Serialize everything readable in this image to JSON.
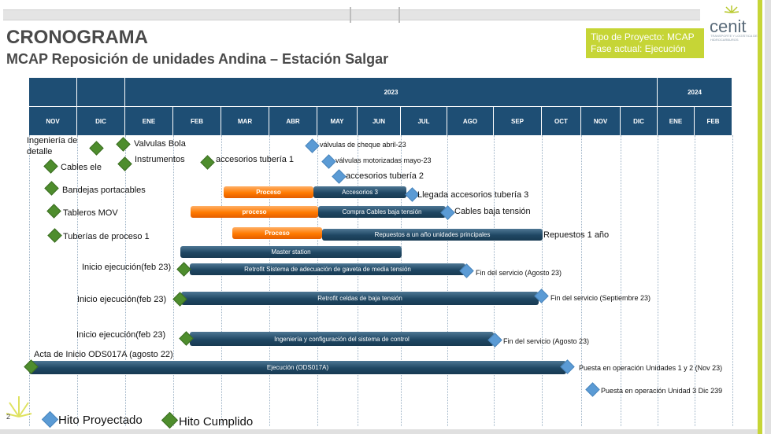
{
  "header": {
    "title": "CRONOGRAMA",
    "subtitle": "MCAP Reposición de unidades Andina – Estación Salgar",
    "project_type": "Tipo de Proyecto: MCAP",
    "phase": "Fase actual: Ejecución",
    "logo": "cenit",
    "logo_tagline": "TRANSPORTE Y LOGÍSTICA DE HIDROCARBUROS"
  },
  "timeline": {
    "years": [
      "2023",
      "2024"
    ],
    "months": [
      "NOV",
      "DIC",
      "ENE",
      "FEB",
      "MAR",
      "ABR",
      "MAY",
      "JUN",
      "JUL",
      "AGO",
      "SEP",
      "OCT",
      "NOV",
      "DIC",
      "ENE",
      "FEB"
    ]
  },
  "chart_data": {
    "type": "gantt",
    "periods": [
      "NOV",
      "DIC",
      "ENE",
      "FEB",
      "MAR",
      "ABR",
      "MAY",
      "JUN",
      "JUL",
      "AGO",
      "SEP",
      "OCT",
      "NOV",
      "DIC",
      "ENE",
      "FEB"
    ],
    "bars": [
      {
        "label": "Proceso",
        "style": "orange"
      },
      {
        "label": "Accesorios 3",
        "style": "dark"
      },
      {
        "label": "proceso",
        "style": "orange"
      },
      {
        "label": "Compra Cables baja tensión",
        "style": "dark"
      },
      {
        "label": "Proceso",
        "style": "orange"
      },
      {
        "label": "Repuestos a un año unidades principales",
        "style": "dark"
      },
      {
        "label": "Master station",
        "style": "dark"
      },
      {
        "label": "Retrofit Sistema de adecuación de gaveta de media tensión",
        "style": "dark"
      },
      {
        "label": "Retrofit celdas de baja tensión",
        "style": "dark"
      },
      {
        "label": "Ingeniería y configuración del sistema de control",
        "style": "dark"
      },
      {
        "label": "Ejecución (ODS017A)",
        "style": "dark"
      }
    ],
    "milestones_completed": [
      "Ingeniería de detalle",
      "Valvulas Bola",
      "Cables ele",
      "Instrumentos",
      "accesorios tubería 1",
      "Bandejas portacables",
      "Tableros MOV",
      "Tuberías de proceso 1",
      "Inicio ejecución(feb 23)",
      "Inicio ejecución(feb 23)",
      "Inicio ejecución(feb 23)",
      "Acta de Inicio ODS017A  (agosto 22)"
    ],
    "milestones_projected": [
      "válvulas de cheque abril-23",
      "válvulas motorizadas mayo-23",
      "accesorios tubería 2",
      "Llegada accesorios tubería 3",
      "Cables baja tensión",
      "Repuestos 1 año",
      "Fin del servicio (Agosto 23)",
      "Fin del servicio (Septiembre 23)",
      "Fin del servicio (Agosto 23)",
      "Puesta en operación Unidades 1 y 2 (Nov 23)",
      "Puesta en operación Unidad 3 Dic 239"
    ]
  },
  "legend": {
    "projected": "Hito Proyectado",
    "completed": "Hito Cumplido"
  },
  "slide_number": "2",
  "colors": {
    "header_blue": "#1e4e74",
    "accent_green": "#c6d536",
    "milestone_done": "#4e8d2d",
    "milestone_projected": "#5b9bd5",
    "bar_orange": "#ff7a00",
    "bar_dark": "#1f4763"
  }
}
